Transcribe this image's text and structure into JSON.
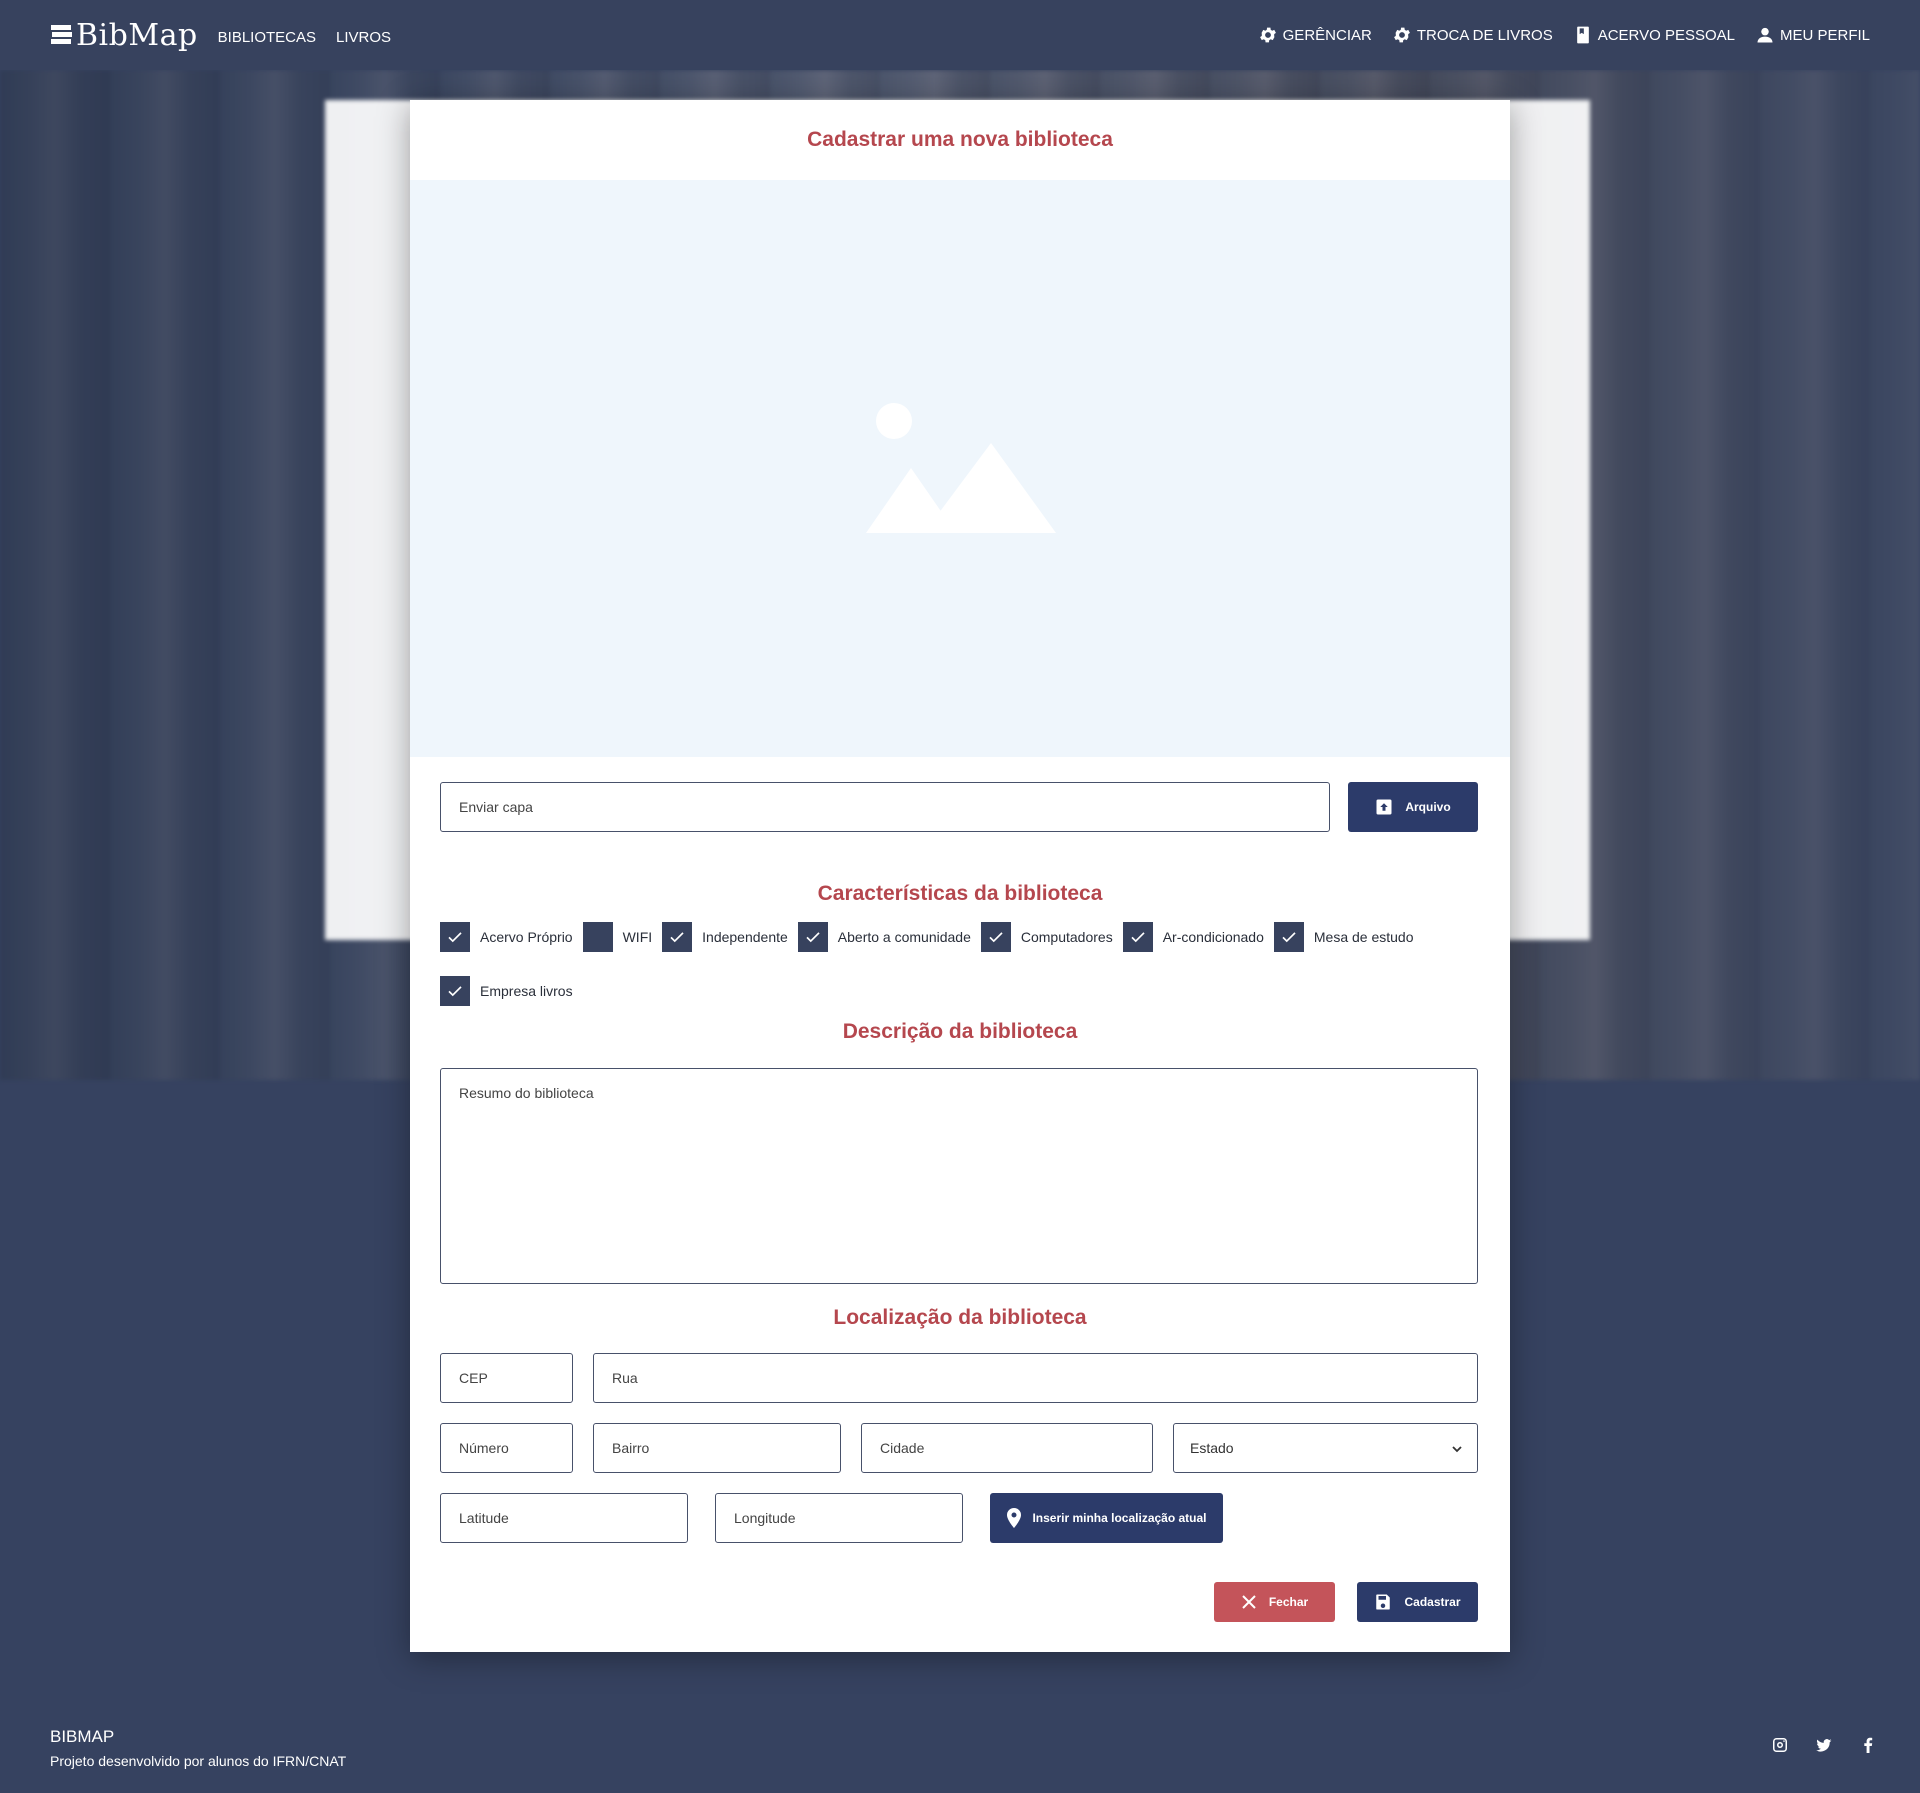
{
  "navbar": {
    "brand": "BibMap",
    "left_links": [
      "BIBLIOTECAS",
      "LIVROS"
    ],
    "right_links": [
      {
        "label": "GERÊNCIAR",
        "icon": "gear-icon"
      },
      {
        "label": "TROCA DE LIVROS",
        "icon": "gear-icon"
      },
      {
        "label": "ACERVO PESSOAL",
        "icon": "book-icon"
      },
      {
        "label": "MEU PERFIL",
        "icon": "user-icon"
      }
    ]
  },
  "modal": {
    "title": "Cadastrar uma nova biblioteca",
    "upload": {
      "placeholder": "Enviar capa",
      "button_label": "Arquivo"
    },
    "features_title": "Características da biblioteca",
    "features": [
      {
        "label": "Acervo Próprio",
        "checked": true
      },
      {
        "label": "WIFI",
        "checked": false
      },
      {
        "label": "Independente",
        "checked": true
      },
      {
        "label": "Aberto a comunidade",
        "checked": true
      },
      {
        "label": "Computadores",
        "checked": true
      },
      {
        "label": "Ar-condicionado",
        "checked": true
      },
      {
        "label": "Mesa de estudo",
        "checked": true
      },
      {
        "label": "Empresa livros",
        "checked": true
      }
    ],
    "description_title": "Descrição da biblioteca",
    "description_placeholder": "Resumo do biblioteca",
    "location_title": "Localização da biblioteca",
    "location": {
      "cep": "CEP",
      "rua": "Rua",
      "numero": "Número",
      "bairro": "Bairro",
      "cidade": "Cidade",
      "estado": "Estado",
      "latitude": "Latitude",
      "longitude": "Longitude",
      "geo_button": "Inserir minha localização atual"
    },
    "close_label": "Fechar",
    "submit_label": "Cadastrar"
  },
  "footer": {
    "brand": "BIBMAP",
    "tagline": "Projeto desenvolvido por alunos do IFRN/CNAT",
    "socials": [
      "instagram-icon",
      "twitter-icon",
      "facebook-icon"
    ]
  },
  "colors": {
    "navbar": "#37425e",
    "accent_red": "#b5474e",
    "button_dark": "#2c3b6a",
    "button_red": "#c4545a",
    "preview_bg": "#eff6fc"
  }
}
